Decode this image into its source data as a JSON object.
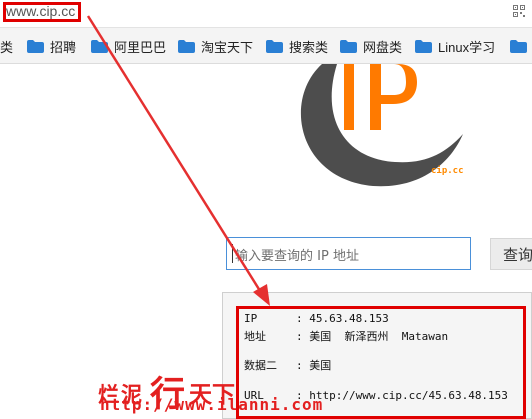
{
  "address_bar": {
    "url": "www.cip.cc"
  },
  "bookmarks": [
    {
      "label": "类"
    },
    {
      "label": "招聘"
    },
    {
      "label": "阿里巴巴"
    },
    {
      "label": "淘宝天下"
    },
    {
      "label": "搜索类"
    },
    {
      "label": "网盘类"
    },
    {
      "label": "Linux学习"
    },
    {
      "label": ""
    }
  ],
  "logo": {
    "text": "IP",
    "subtext": "cip.cc",
    "accent_color": "#ff7a00",
    "crescent_color": "#4d4d4d"
  },
  "search": {
    "placeholder": "输入要查询的 IP 地址",
    "button_label": "查询"
  },
  "result": {
    "rows": [
      {
        "key": "IP",
        "sep": ": ",
        "value": "45.63.48.153"
      },
      {
        "key": "地址",
        "sep": ": ",
        "value": "美国  新泽西州  Matawan"
      },
      {
        "key": "数据二",
        "sep": ": ",
        "value": "美国"
      },
      {
        "key": "URL",
        "sep": ": ",
        "value": "http://www.cip.cc/45.63.48.153"
      }
    ]
  },
  "watermark": {
    "title_part1": "烂泥",
    "title_part2": "行",
    "title_part3": "天下",
    "url": "http://www.ilanni.com",
    "color": "#e32020"
  },
  "colors": {
    "highlight": "#e00000",
    "search_border": "#4a90d9"
  }
}
